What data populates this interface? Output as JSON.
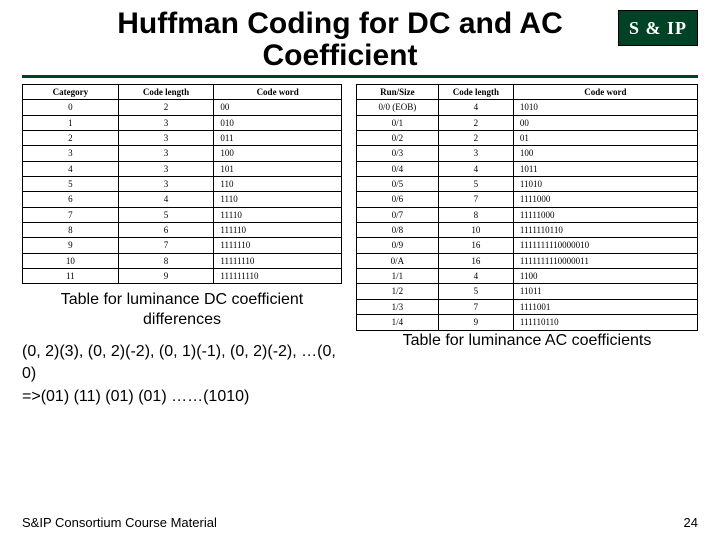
{
  "title": "Huffman Coding for DC and AC Coefficient",
  "logo_text": "S & IP",
  "dc_table": {
    "headers": [
      "Category",
      "Code length",
      "Code word"
    ],
    "rows": [
      [
        "0",
        "2",
        "00"
      ],
      [
        "1",
        "3",
        "010"
      ],
      [
        "2",
        "3",
        "011"
      ],
      [
        "3",
        "3",
        "100"
      ],
      [
        "4",
        "3",
        "101"
      ],
      [
        "5",
        "3",
        "110"
      ],
      [
        "6",
        "4",
        "1110"
      ],
      [
        "7",
        "5",
        "11110"
      ],
      [
        "8",
        "6",
        "111110"
      ],
      [
        "9",
        "7",
        "1111110"
      ],
      [
        "10",
        "8",
        "11111110"
      ],
      [
        "11",
        "9",
        "111111110"
      ]
    ],
    "caption": "Table for luminance DC coefficient differences"
  },
  "ac_table": {
    "headers": [
      "Run/Size",
      "Code length",
      "Code word"
    ],
    "rows": [
      [
        "0/0 (EOB)",
        "4",
        "1010"
      ],
      [
        "0/1",
        "2",
        "00"
      ],
      [
        "0/2",
        "2",
        "01"
      ],
      [
        "0/3",
        "3",
        "100"
      ],
      [
        "0/4",
        "4",
        "1011"
      ],
      [
        "0/5",
        "5",
        "11010"
      ],
      [
        "0/6",
        "7",
        "1111000"
      ],
      [
        "0/7",
        "8",
        "11111000"
      ],
      [
        "0/8",
        "10",
        "1111110110"
      ],
      [
        "0/9",
        "16",
        "1111111110000010"
      ],
      [
        "0/A",
        "16",
        "1111111110000011"
      ],
      [
        "1/1",
        "4",
        "1100"
      ],
      [
        "1/2",
        "5",
        "11011"
      ],
      [
        "1/3",
        "7",
        "1111001"
      ],
      [
        "1/4",
        "9",
        "111110110"
      ]
    ],
    "caption": "Table for luminance AC coefficients"
  },
  "example_line1": "(0, 2)(3), (0, 2)(-2), (0, 1)(-1), (0, 2)(-2), …(0, 0)",
  "example_line2": "=>(01) (11) (01) (01) ……(1010)",
  "footer": "S&IP Consortium Course Material",
  "page_number": "24"
}
